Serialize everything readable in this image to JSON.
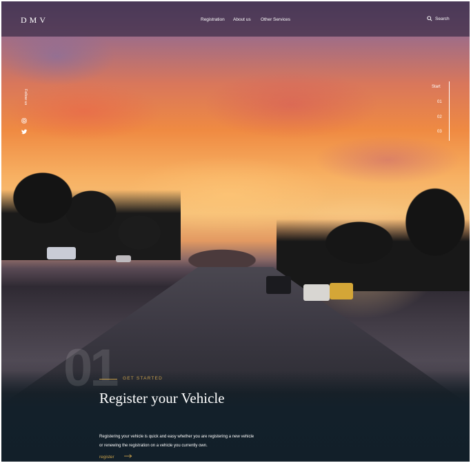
{
  "header": {
    "logo": "DMV",
    "nav": [
      "Registration",
      "About us",
      "Other Services"
    ],
    "search_label": "Search"
  },
  "social": {
    "follow_label": "Follow us",
    "icons": [
      "instagram-icon",
      "twitter-icon"
    ]
  },
  "steps": [
    "Start",
    "01",
    "02",
    "03"
  ],
  "hero": {
    "number": "01",
    "eyebrow": "GET STARTED",
    "headline": "Register your Vehicle",
    "description": "Registering your vehicle is quick and easy whether you are registering a new vehicle or renewing the registration on a vehicle you currently own.",
    "cta_label": "register"
  },
  "colors": {
    "accent": "#c9a04b",
    "dark_panel": "#13202a"
  }
}
